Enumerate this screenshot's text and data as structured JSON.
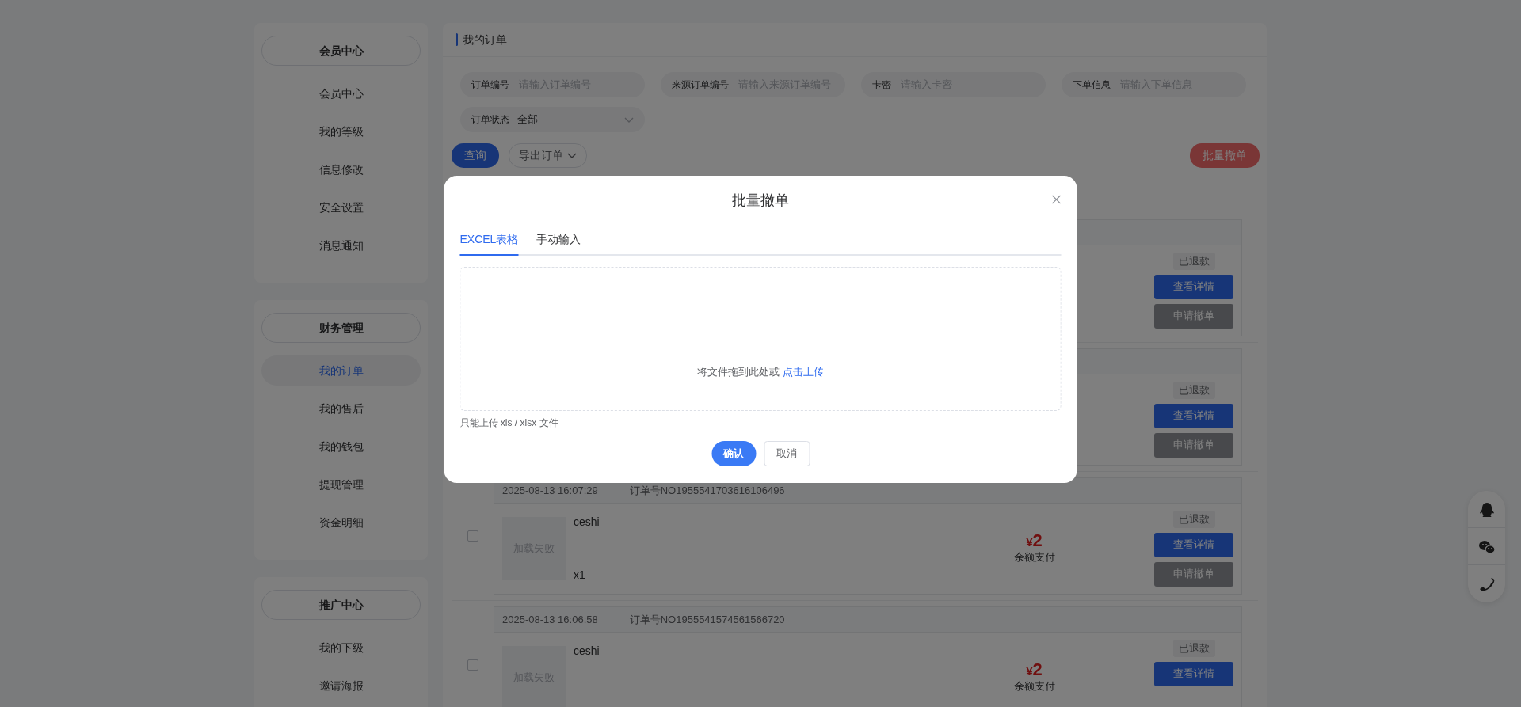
{
  "sidebar": [
    {
      "title": "会员中心",
      "items": [
        {
          "label": "会员中心",
          "selected": false
        },
        {
          "label": "我的等级",
          "selected": false
        },
        {
          "label": "信息修改",
          "selected": false
        },
        {
          "label": "安全设置",
          "selected": false
        },
        {
          "label": "消息通知",
          "selected": false
        }
      ]
    },
    {
      "title": "财务管理",
      "items": [
        {
          "label": "我的订单",
          "selected": true
        },
        {
          "label": "我的售后",
          "selected": false
        },
        {
          "label": "我的钱包",
          "selected": false
        },
        {
          "label": "提现管理",
          "selected": false
        },
        {
          "label": "资金明细",
          "selected": false
        }
      ]
    },
    {
      "title": "推广中心",
      "items": [
        {
          "label": "我的下级",
          "selected": false
        },
        {
          "label": "邀请海报",
          "selected": false
        }
      ]
    }
  ],
  "page_title": "我的订单",
  "filters": [
    {
      "kind": "text",
      "label": "订单编号",
      "placeholder": "请输入订单编号"
    },
    {
      "kind": "text",
      "label": "来源订单编号",
      "placeholder": "请输入来源订单编号"
    },
    {
      "kind": "text",
      "label": "卡密",
      "placeholder": "请输入卡密"
    },
    {
      "kind": "text",
      "label": "下单信息",
      "placeholder": "请输入下单信息"
    },
    {
      "kind": "select",
      "label": "订单状态",
      "value": "全部"
    }
  ],
  "toolbar": {
    "query": "查询",
    "export": "导出订单",
    "batch_cancel": "批量撤单"
  },
  "orders": [
    {
      "status": "已退款",
      "actions": [
        "查看详情",
        "申请撤单"
      ]
    },
    {
      "status": "已退款",
      "actions": [
        "查看详情",
        "申请撤单"
      ]
    },
    {
      "selected": false,
      "time": "2025-08-13 16:07:29",
      "order_no": "订单号NO1955541703616106496",
      "image_text": "加载失败",
      "product": "ceshi",
      "quantity": "x1",
      "currency": "¥",
      "price": "2",
      "payment": "余额支付",
      "status": "已退款",
      "actions": [
        "查看详情",
        "申请撤单"
      ]
    },
    {
      "selected": false,
      "time": "2025-08-13 16:06:58",
      "order_no": "订单号NO1955541574561566720",
      "image_text": "加载失败",
      "product": "ceshi",
      "currency": "¥",
      "price": "2",
      "payment": "余额支付",
      "status": "已退款",
      "actions": [
        "查看详情"
      ]
    }
  ],
  "modal": {
    "title": "批量撤单",
    "tabs": [
      {
        "label": "EXCEL表格",
        "selected": true
      },
      {
        "label": "手动输入",
        "selected": false
      }
    ],
    "upload_text": "将文件拖到此处或",
    "upload_link": "点击上传",
    "hint": "只能上传 xls / xlsx 文件",
    "buttons": [
      {
        "kind": "primary",
        "label": "确认"
      },
      {
        "kind": "default",
        "label": "取消"
      }
    ]
  }
}
